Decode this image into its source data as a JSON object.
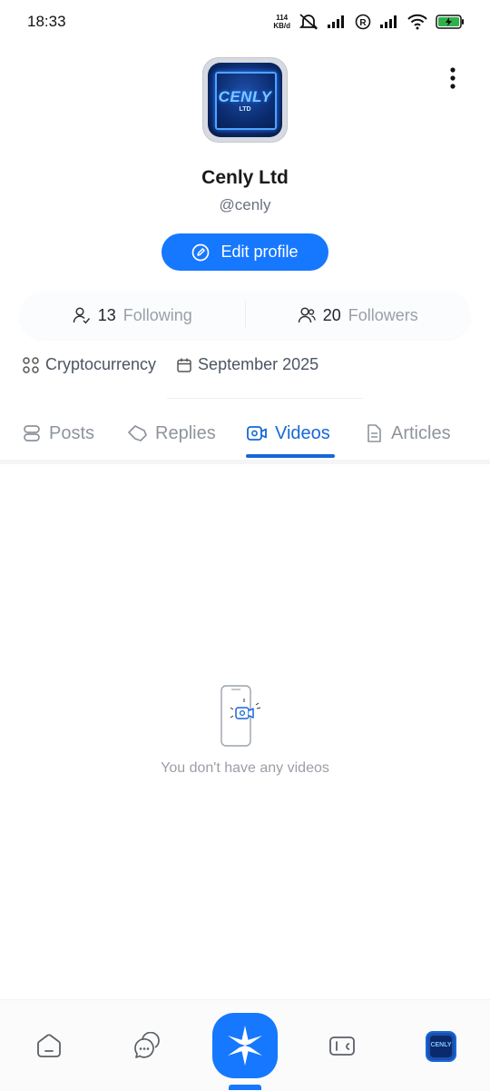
{
  "status_bar": {
    "time": "18:33",
    "speed_value": "114",
    "speed_unit": "KB/d",
    "battery_color": "#2fb14a"
  },
  "profile": {
    "avatar_text": "CENLY",
    "avatar_subtext": "LTD",
    "name": "Cenly Ltd",
    "handle": "@cenly",
    "edit_button": "Edit profile",
    "following_count": "13",
    "following_label": "Following",
    "followers_count": "20",
    "followers_label": "Followers",
    "category": "Cryptocurrency",
    "joined": "September 2025"
  },
  "tabs": [
    {
      "label": "Posts",
      "icon": "posts-icon",
      "active": false
    },
    {
      "label": "Replies",
      "icon": "replies-icon",
      "active": false
    },
    {
      "label": "Videos",
      "icon": "video-icon",
      "active": true
    },
    {
      "label": "Articles",
      "icon": "article-icon",
      "active": false
    }
  ],
  "empty_state": {
    "message": "You don't have any videos"
  },
  "bottom_nav": {
    "avatar_text": "CENLY",
    "accent": "#1677ff"
  }
}
